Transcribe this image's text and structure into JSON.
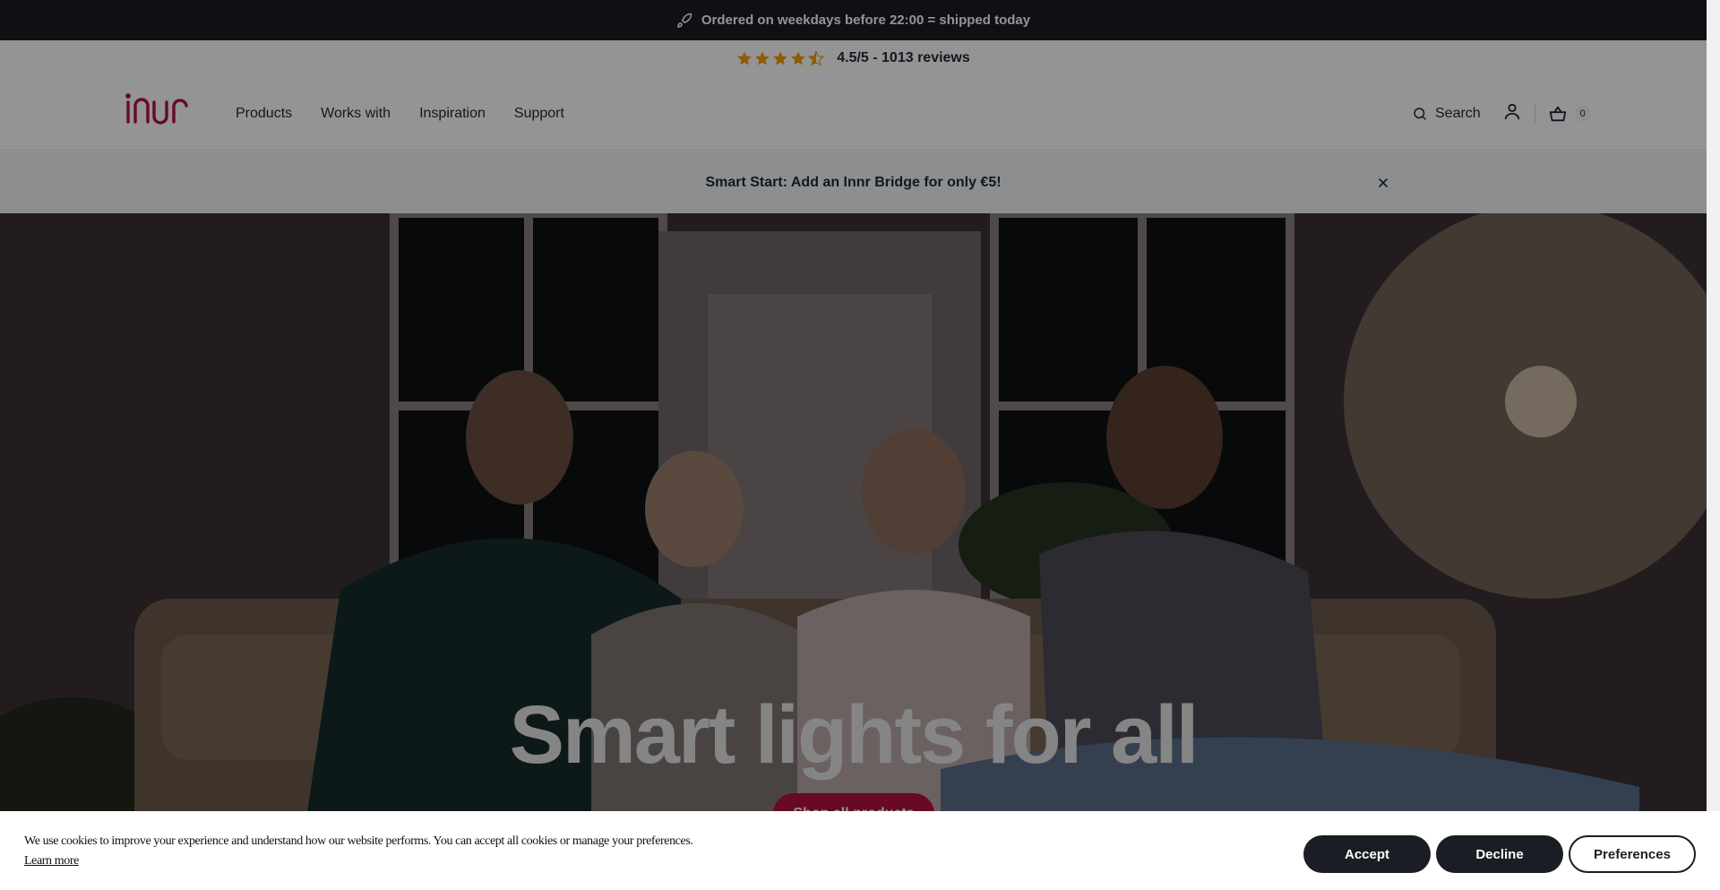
{
  "announcement": {
    "text": "Ordered on weekdays before 22:00 = shipped today",
    "icon": "rocket-icon"
  },
  "rating": {
    "value": 4.5,
    "text": "4.5/5 - 1013 reviews",
    "star_color": "#f59e0b"
  },
  "header": {
    "brand_color": "#b3123e",
    "nav": [
      "Products",
      "Works with",
      "Inspiration",
      "Support"
    ],
    "search_label": "Search",
    "cart_count": "0"
  },
  "promo": {
    "text": "Smart Start: Add an Innr Bridge for only €5!"
  },
  "hero": {
    "title": "Smart lights for all",
    "cta_label": "Shop all products"
  },
  "cookie": {
    "text": "We use cookies to improve your experience and understand how our website performs. You can accept all cookies or manage your preferences.",
    "learn_more": "Learn more",
    "accept": "Accept",
    "decline": "Decline",
    "preferences": "Preferences"
  }
}
